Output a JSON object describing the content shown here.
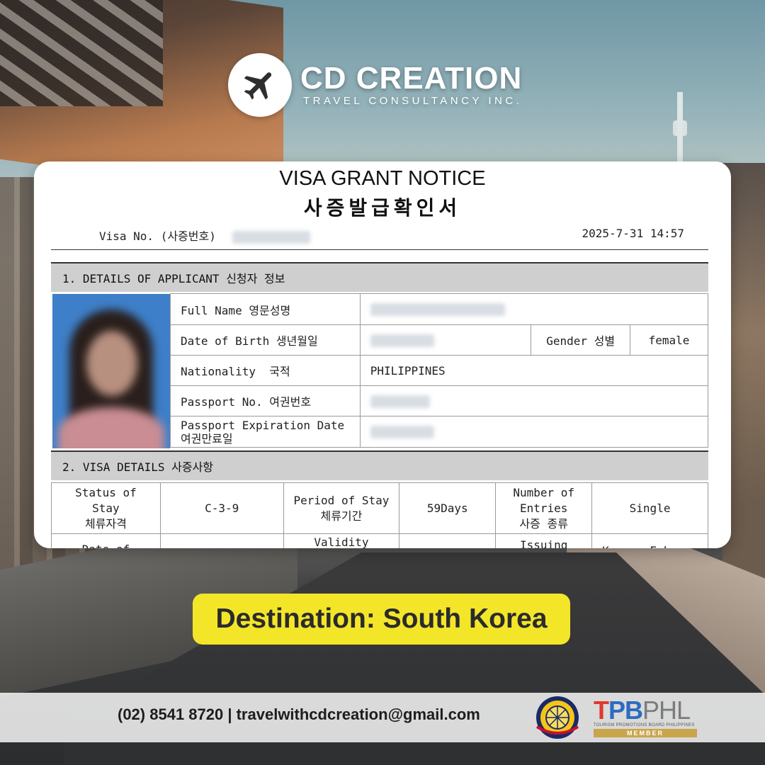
{
  "brand": {
    "name": "CD CREATION",
    "subtitle": "TRAVEL CONSULTANCY INC.",
    "logo_icon": "airplane-icon"
  },
  "document": {
    "title_en": "VISA GRANT NOTICE",
    "title_ko": "사증발급확인서",
    "visa_no_label": "Visa No. (사증번호)",
    "datetime": "2025-7-31 14:57",
    "section1": "1. DETAILS OF APPLICANT 신청자 정보",
    "section2": "2. VISA DETAILS 사증사항",
    "applicant": {
      "full_name_label": "Full Name 영문성명",
      "dob_label": "Date of Birth 생년월일",
      "gender_label": "Gender 성별",
      "gender_value": "female",
      "nationality_label": "Nationality  국적",
      "nationality_value": "PHILIPPINES",
      "passport_label": "Passport No. 여권번호",
      "expiry_label_1": "Passport Expiration Date",
      "expiry_label_2": "여권만료일"
    },
    "visa": {
      "status_label_1": "Status of Stay",
      "status_label_2": "체류자격",
      "status_value": "C-3-9",
      "period_label_1": "Period of Stay",
      "period_label_2": "체류기간",
      "period_value": "59Days",
      "entries_label_1": "Number of",
      "entries_label_2": "Entries",
      "entries_label_3": "사증 종류",
      "entries_value": "Single",
      "issue_label": "Date of Issue",
      "validity_label": "Validity Period",
      "issuing_label": "Issuing",
      "issuing_value": "Korean Embassy"
    }
  },
  "destination": "Destination: South Korea",
  "footer": {
    "contact": "(02) 8541 8720 | travelwithcdcreation@gmail.com",
    "tpb_part1": "T",
    "tpb_part2": "PB",
    "tpb_part3": "PHL",
    "tpb_small": "TOURISM PROMOTIONS BOARD PHILIPPINES",
    "tpb_member": "MEMBER"
  }
}
